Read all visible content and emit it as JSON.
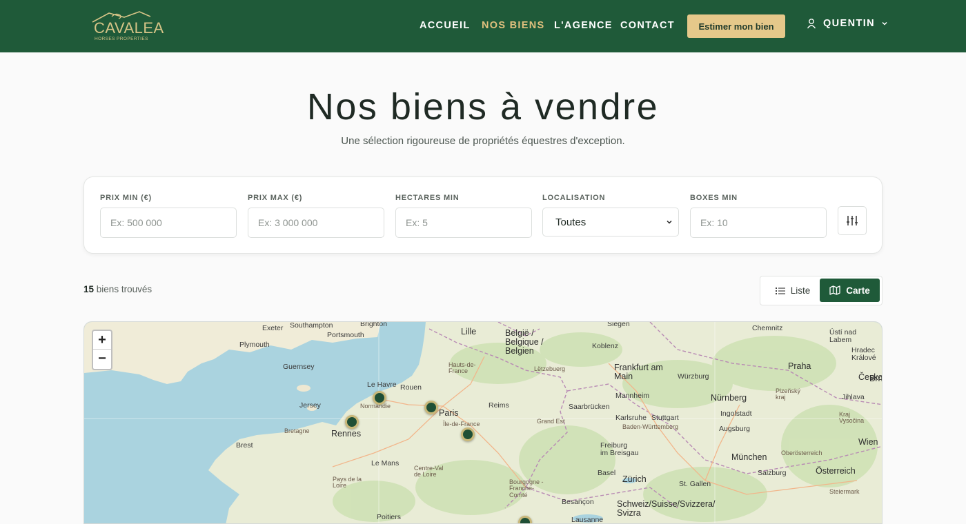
{
  "header": {
    "logo": {
      "word": "CAVALEA",
      "sub": "HORSES PROPERTIES"
    },
    "nav": [
      {
        "label": "ACCUEIL"
      },
      {
        "label": "NOS BIENS"
      },
      {
        "label": "L'AGENCE"
      },
      {
        "label": "CONTACT"
      }
    ],
    "cta_label": "Estimer mon bien",
    "user_label": "QUENTIN"
  },
  "hero": {
    "title": "Nos biens à vendre",
    "subtitle": "Une sélection rigoureuse de propriétés équestres d'exception."
  },
  "filters": {
    "prix_min": {
      "label": "PRIX MIN (€)",
      "placeholder": "Ex: 500 000"
    },
    "prix_max": {
      "label": "PRIX MAX (€)",
      "placeholder": "Ex: 3 000 000"
    },
    "hectares": {
      "label": "HECTARES MIN",
      "placeholder": "Ex: 5"
    },
    "localisation": {
      "label": "LOCALISATION",
      "value": "Toutes"
    },
    "boxes": {
      "label": "BOXES MIN",
      "placeholder": "Ex: 10"
    }
  },
  "results": {
    "count": "15",
    "count_suffix": "biens trouvés"
  },
  "view_toggle": {
    "list_label": "Liste",
    "map_label": "Carte",
    "active": "map"
  },
  "map": {
    "zoom_in": "+",
    "zoom_out": "−",
    "cities": {
      "exeter": "Exeter",
      "southampton": "Southampton",
      "brighton": "Brighton",
      "plymouth": "Plymouth",
      "portsmouth": "Portsmouth",
      "lille": "Lille",
      "belgique": "België /\nBelgique /\nBelgien",
      "siegen": "Siegen",
      "koblenz": "Koblenz",
      "chemnitz": "Chemnitz",
      "usti": "Ústí nad\nLabem",
      "hradec": "Hradec\nKrálové",
      "praha": "Praha",
      "frankfurt": "Frankfurt am\nMain",
      "wurzburg": "Würzburg",
      "cesko": "Česko",
      "guernsey": "Guernsey",
      "lehavre": "Le Havre",
      "rouen": "Rouen",
      "hautsdefrance": "Hauts-de-\nFrance",
      "luxembourg": "Lëtzebuerg",
      "mannheim": "Mannheim",
      "nurnberg": "Nürnberg",
      "plzen": "Plzeňský\nkraj",
      "jihlava": "Jihlava",
      "vysocina": "Kraj\nVysočina",
      "jersey": "Jersey",
      "normandie": "Normandie",
      "paris": "Paris",
      "reims": "Reims",
      "saarbrucken": "Saarbrücken",
      "karlsruhe": "Karlsruhe",
      "badenwurttemberg": "Baden-Württemberg",
      "ingolstadt": "Ingolstadt",
      "grandest": "Grand Est",
      "bretagne": "Bretagne",
      "rennes": "Rennes",
      "iledefrance": "Île-de-France",
      "stuttgart": "Stuttgart",
      "augsburg": "Augsburg",
      "brest": "Brest",
      "freiburg": "Freiburg\nim Breisgau",
      "munchen": "München",
      "wien": "Wien",
      "lemans": "Le Mans",
      "centreval": "Centre-Val\nde Loire",
      "oberosterreich": "Oberösterreich",
      "basel": "Basel",
      "zurich": "Zürich",
      "stgallen": "St. Gallen",
      "salzburg": "Salzburg",
      "osterreich": "Österreich",
      "paysdelaloire": "Pays de la\nLoire",
      "bourgogne": "Bourgogne -\nFranche-\nComté",
      "besancon": "Besançon",
      "schweiz": "Schweiz/Suisse/Svizzera/\nSvizra",
      "steiermark": "Steiermark",
      "lausanne": "Lausanne",
      "poitiers": "Poitiers",
      "brno": "Brno"
    }
  },
  "colors": {
    "primary": "#1f5a39",
    "accent": "#e5c88a",
    "nav_active": "#e0c07e"
  }
}
